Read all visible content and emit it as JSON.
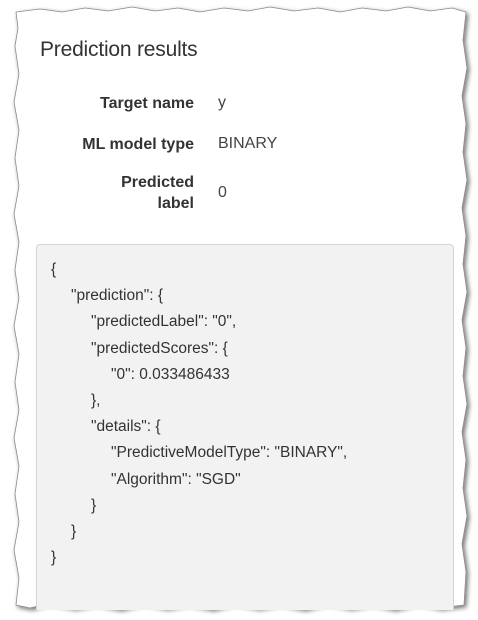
{
  "panel": {
    "title": "Prediction results"
  },
  "details": {
    "target_name_label": "Target name",
    "target_name_value": "y",
    "model_type_label": "ML model type",
    "model_type_value": "BINARY",
    "predicted_label_label_line1": "Predicted",
    "predicted_label_label_line2": "label",
    "predicted_label_value": "0"
  },
  "json_output": {
    "lines": [
      "{",
      "\"prediction\": {",
      "\"predictedLabel\": \"0\",",
      "\"predictedScores\": {",
      "\"0\": 0.033486433",
      "},",
      "\"details\": {",
      "\"PredictiveModelType\": \"BINARY\",",
      "\"Algorithm\": \"SGD\"",
      "}",
      "}",
      "}"
    ]
  },
  "colors": {
    "code_background": "#f2f2f2",
    "code_border": "#d4d4d4",
    "text": "#333333"
  }
}
